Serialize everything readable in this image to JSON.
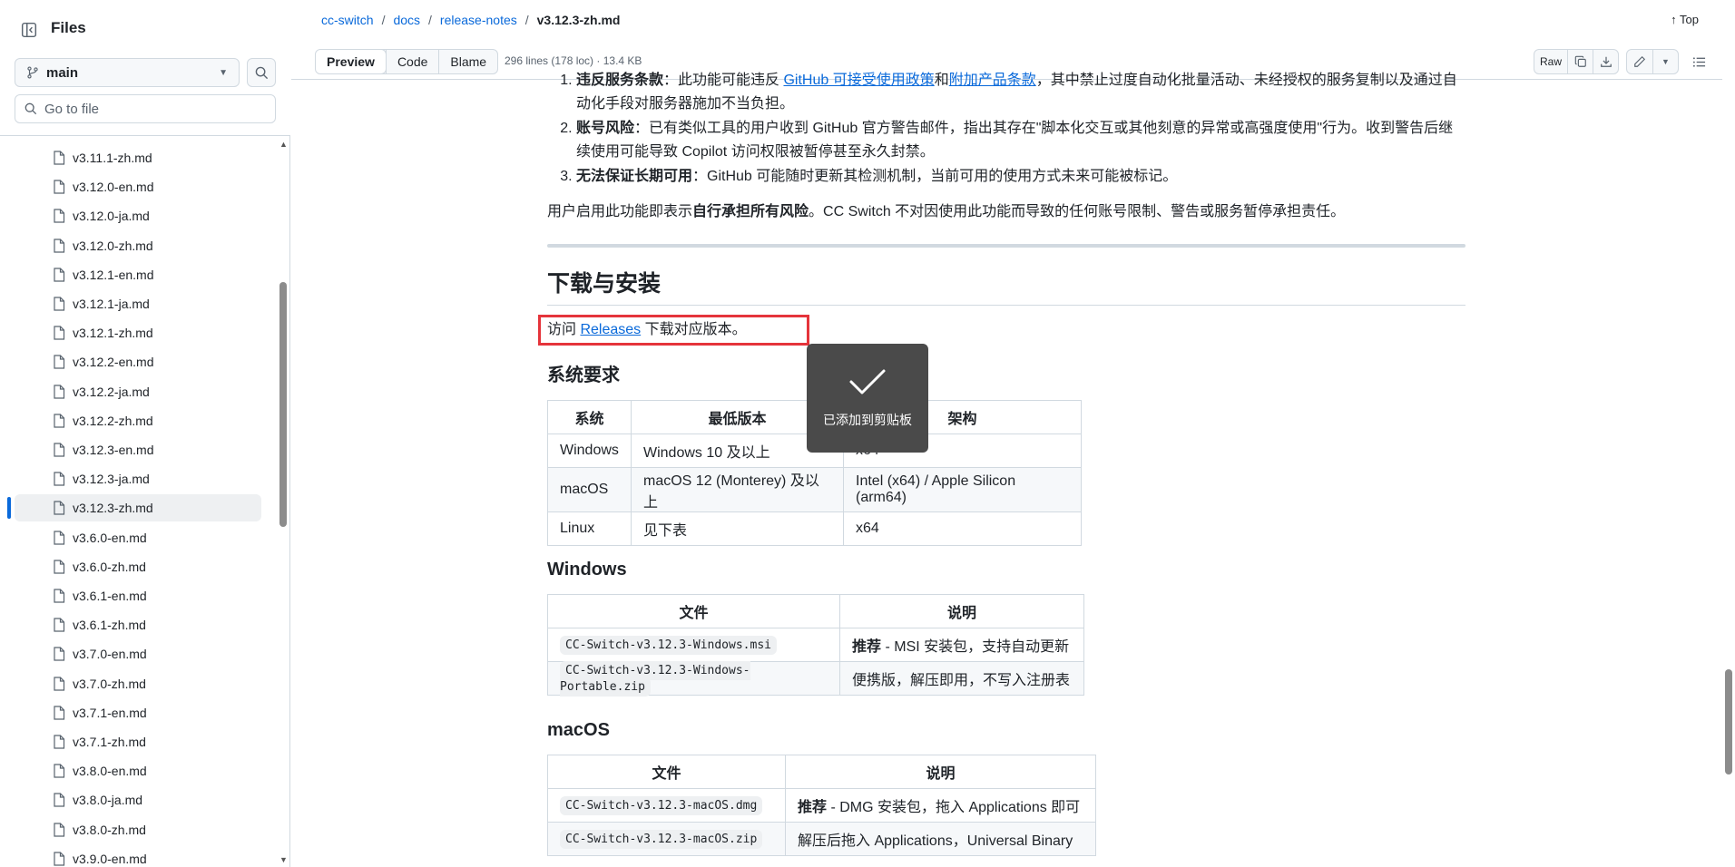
{
  "sidebar": {
    "title": "Files",
    "branch": "main",
    "goto_placeholder": "Go to file",
    "files": [
      "v3.11.1-zh.md",
      "v3.12.0-en.md",
      "v3.12.0-ja.md",
      "v3.12.0-zh.md",
      "v3.12.1-en.md",
      "v3.12.1-ja.md",
      "v3.12.1-zh.md",
      "v3.12.2-en.md",
      "v3.12.2-ja.md",
      "v3.12.2-zh.md",
      "v3.12.3-en.md",
      "v3.12.3-ja.md",
      "v3.12.3-zh.md",
      "v3.6.0-en.md",
      "v3.6.0-zh.md",
      "v3.6.1-en.md",
      "v3.6.1-zh.md",
      "v3.7.0-en.md",
      "v3.7.0-zh.md",
      "v3.7.1-en.md",
      "v3.7.1-zh.md",
      "v3.8.0-en.md",
      "v3.8.0-ja.md",
      "v3.8.0-zh.md",
      "v3.9.0-en.md"
    ],
    "active_file": "v3.12.3-zh.md"
  },
  "header": {
    "breadcrumb": [
      "cc-switch",
      "docs",
      "release-notes"
    ],
    "current": "v3.12.3-zh.md",
    "top_label": "Top",
    "tabs": [
      "Preview",
      "Code",
      "Blame"
    ],
    "meta": "296 lines (178 loc) · 13.4 KB",
    "raw_label": "Raw"
  },
  "content": {
    "risk1_bold": "违反服务条款",
    "risk1_a": "：此功能可能违反 ",
    "risk1_link1": "GitHub 可接受使用政策",
    "risk1_b": "和",
    "risk1_link2": "附加产品条款",
    "risk1_c": "，其中禁止过度自动化批量活动、未经授权的服务复制以及通过自动化手段对服务器施加不当负担。",
    "risk2_bold": "账号风险",
    "risk2_text": "：已有类似工具的用户收到 GitHub 官方警告邮件，指出其存在\"脚本化交互或其他刻意的异常或高强度使用\"行为。收到警告后继续使用可能导致 Copilot 访问权限被暂停甚至永久封禁。",
    "risk3_bold": "无法保证长期可用",
    "risk3_text": "：GitHub 可能随时更新其检测机制，当前可用的使用方式未来可能被标记。",
    "para_a": "用户启用此功能即表示",
    "para_bold": "自行承担所有风险",
    "para_b": "。CC Switch 不对因使用此功能而导致的任何账号限制、警告或服务暂停承担责任。",
    "h2": "下载与安装",
    "visit_a": "访问 ",
    "visit_link": "Releases",
    "visit_b": " 下载对应版本。",
    "h3_sys": "系统要求",
    "sys_headers": [
      "系统",
      "最低版本",
      "架构"
    ],
    "sys_rows": [
      [
        "Windows",
        "Windows 10 及以上",
        "x64"
      ],
      [
        "macOS",
        "macOS 12 (Monterey) 及以上",
        "Intel (x64) / Apple Silicon (arm64)"
      ],
      [
        "Linux",
        "见下表",
        "x64"
      ]
    ],
    "h3_win": "Windows",
    "win_headers": [
      "文件",
      "说明"
    ],
    "win_rows": [
      [
        "CC-Switch-v3.12.3-Windows.msi",
        "推荐",
        " - MSI 安装包，支持自动更新"
      ],
      [
        "CC-Switch-v3.12.3-Windows-Portable.zip",
        "",
        "便携版，解压即用，不写入注册表"
      ]
    ],
    "h3_mac": "macOS",
    "mac_headers": [
      "文件",
      "说明"
    ],
    "mac_rows": [
      [
        "CC-Switch-v3.12.3-macOS.dmg",
        "推荐",
        " - DMG 安装包，拖入 Applications 即可"
      ],
      [
        "CC-Switch-v3.12.3-macOS.zip",
        "",
        "解压后拖入 Applications，Universal Binary"
      ]
    ]
  },
  "toast": {
    "message": "已添加到剪贴板"
  }
}
